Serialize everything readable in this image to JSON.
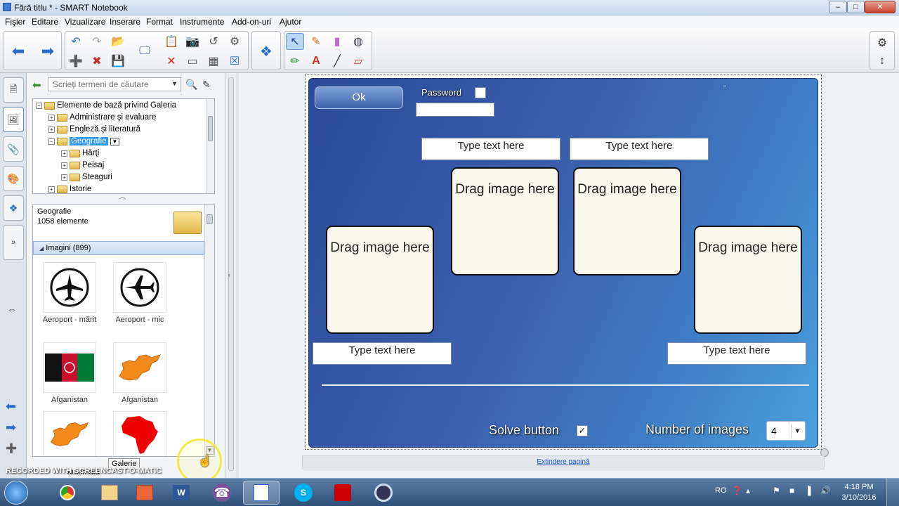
{
  "window": {
    "title": "Fără titlu * - SMART Notebook",
    "controls": {
      "minimize": "–",
      "maximize": "□",
      "close": "✕"
    }
  },
  "menubar": [
    "Fişier",
    "Editare",
    "Vizualizare",
    "Inserare",
    "Format",
    "Instrumente",
    "Add-on-uri",
    "Ajutor"
  ],
  "gallery": {
    "search_placeholder": "Scrieţi termeni de căutare",
    "tree": [
      {
        "label": "Elemente de bază privind Galeria",
        "level": 0,
        "expander": "−"
      },
      {
        "label": "Administrare şi evaluare",
        "level": 1,
        "expander": "+"
      },
      {
        "label": "Engleză şi literatură",
        "level": 1,
        "expander": "+"
      },
      {
        "label": "Geografie",
        "level": 1,
        "expander": "−",
        "selected": true
      },
      {
        "label": "Hărţi",
        "level": 2,
        "expander": "+"
      },
      {
        "label": "Peisaj",
        "level": 2,
        "expander": "+"
      },
      {
        "label": "Steaguri",
        "level": 2,
        "expander": "+"
      },
      {
        "label": "Istorie",
        "level": 1,
        "expander": "+"
      }
    ],
    "category_name": "Geografie",
    "category_count": "1058 elemente",
    "section_header": "Imagini (899)",
    "items": [
      {
        "label": "Aeroport - mărit",
        "icon": "airport-large-icon"
      },
      {
        "label": "Aeroport - mic",
        "icon": "airport-small-icon"
      },
      {
        "label": "Afganistan",
        "icon": "afghanistan-flag"
      },
      {
        "label": "Afganistan",
        "icon": "afghanistan-map"
      },
      {
        "label": "",
        "icon": "afghanistan-map-2"
      },
      {
        "label": "",
        "icon": "africa-map"
      }
    ],
    "tooltip": "Galerie",
    "auto_hide_label": "automată"
  },
  "board": {
    "ok_label": "Ok",
    "password_label": "Password",
    "top_textboxes": [
      "Type text here",
      "Type text here"
    ],
    "side_textboxes": [
      "Type text here",
      "Type text here"
    ],
    "cards": [
      "Drag image here",
      "Drag image here",
      "Drag image here",
      "Drag image here"
    ],
    "solve_label": "Solve button",
    "solve_checked": true,
    "images_label": "Number of images",
    "images_value": "4",
    "corner_mark": "''"
  },
  "extend_page_link": "Extindere pagină",
  "watermark": "RECORDED WITH SCREENCAST-O-MATIC",
  "taskbar": {
    "language": "RO",
    "time": "4:18 PM",
    "date": "3/10/2016"
  },
  "colors": {
    "board_start": "#2c4a97",
    "board_end": "#4aa0dc",
    "selection": "#3399ff",
    "cursor_highlight": "#f5e94a"
  }
}
